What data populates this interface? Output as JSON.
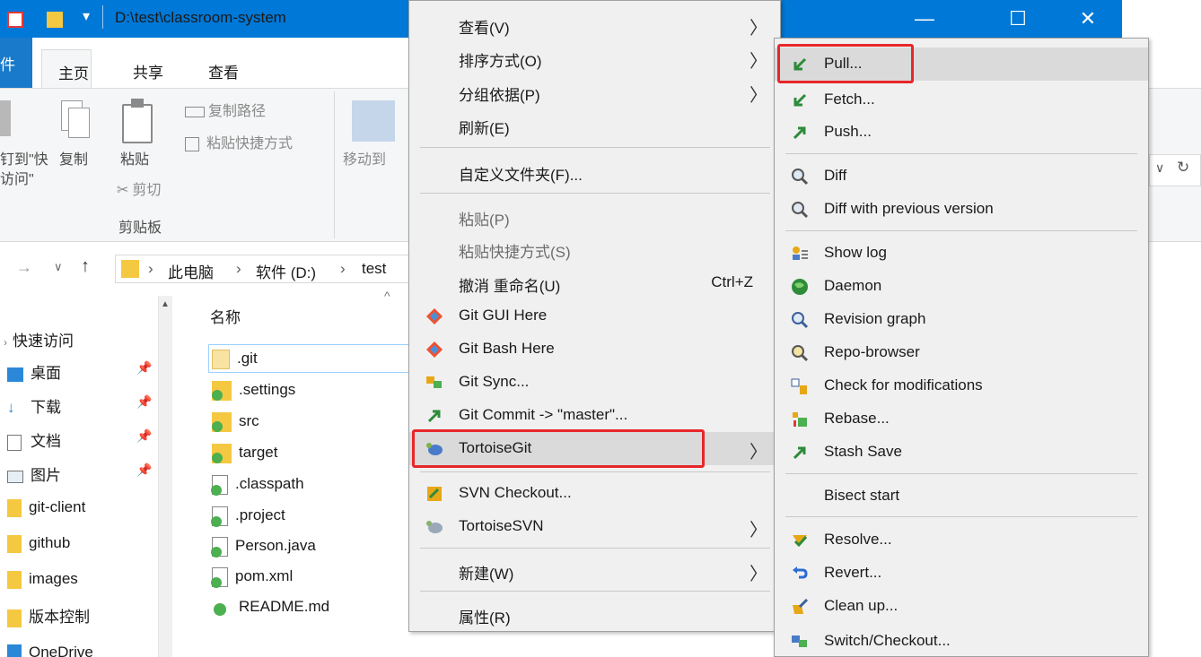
{
  "window": {
    "title": "D:\\test\\classroom-system",
    "minimize": "—",
    "maximize": "☐",
    "close": "✕"
  },
  "ribbon": {
    "tabs": [
      "主页",
      "共享",
      "查看"
    ],
    "file_tab_fragment": "件",
    "copy_path": "复制路径",
    "paste_shortcut": "粘贴快捷方式",
    "pin_fragment_1": "钉到\"快",
    "pin_fragment_2": "访问\"",
    "copy": "复制",
    "paste": "粘贴",
    "cut": "剪切",
    "clipboard_group": "剪贴板",
    "move_to": "移动到",
    "refresh_fragment": "↻"
  },
  "address": {
    "crumbs": [
      "此电脑",
      "软件 (D:)",
      "test"
    ],
    "sep": "›"
  },
  "nav": {
    "items": [
      {
        "label": "快速访问"
      },
      {
        "label": "桌面"
      },
      {
        "label": "下载"
      },
      {
        "label": "文档"
      },
      {
        "label": "图片"
      },
      {
        "label": "git-client"
      },
      {
        "label": "github"
      },
      {
        "label": "images"
      },
      {
        "label": "版本控制"
      },
      {
        "label": "OneDrive"
      }
    ]
  },
  "files": {
    "column_name": "名称",
    "items": [
      {
        "name": ".git"
      },
      {
        "name": ".settings"
      },
      {
        "name": "src"
      },
      {
        "name": "target"
      },
      {
        "name": ".classpath"
      },
      {
        "name": ".project"
      },
      {
        "name": "Person.java"
      },
      {
        "name": "pom.xml"
      },
      {
        "name": "README.md"
      }
    ]
  },
  "context_menu": {
    "view": "查看(V)",
    "sort_by": "排序方式(O)",
    "group_by": "分组依据(P)",
    "refresh": "刷新(E)",
    "customize_folder": "自定义文件夹(F)...",
    "paste": "粘贴(P)",
    "paste_shortcut": "粘贴快捷方式(S)",
    "undo_rename": "撤消 重命名(U)",
    "undo_shortcut": "Ctrl+Z",
    "git_gui": "Git GUI Here",
    "git_bash": "Git Bash Here",
    "git_sync": "Git Sync...",
    "git_commit": "Git Commit -> \"master\"...",
    "tortoisegit": "TortoiseGit",
    "svn_checkout": "SVN Checkout...",
    "tortoisesvn": "TortoiseSVN",
    "new": "新建(W)",
    "properties": "属性(R)",
    "arrow": "〉"
  },
  "submenu": {
    "pull": "Pull...",
    "fetch": "Fetch...",
    "push": "Push...",
    "diff": "Diff",
    "diff_prev": "Diff with previous version",
    "show_log": "Show log",
    "daemon": "Daemon",
    "revision_graph": "Revision graph",
    "repo_browser": "Repo-browser",
    "check_mods": "Check for modifications",
    "rebase": "Rebase...",
    "stash_save": "Stash Save",
    "bisect_start": "Bisect start",
    "resolve": "Resolve...",
    "revert": "Revert...",
    "clean_up": "Clean up...",
    "switch_checkout": "Switch/Checkout..."
  },
  "colors": {
    "titlebar": "#0078d7",
    "highlight_box": "#e8262a",
    "menu_bg": "#f0f0f0"
  }
}
